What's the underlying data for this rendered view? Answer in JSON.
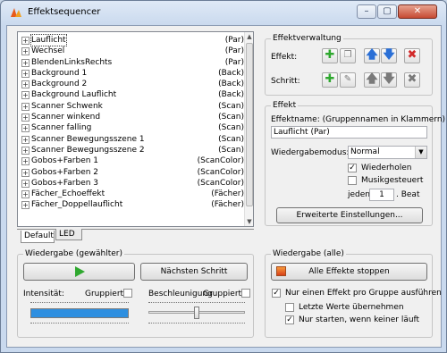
{
  "window": {
    "title": "Effektsequencer",
    "controls": [
      "–",
      "▢",
      "✕"
    ]
  },
  "effects": [
    {
      "name": "Lauflicht",
      "type": "(Par)",
      "selected": true
    },
    {
      "name": "Wechsel",
      "type": "(Par)"
    },
    {
      "name": "BlendenLinksRechts",
      "type": "(Par)"
    },
    {
      "name": "Background 1",
      "type": "(Back)"
    },
    {
      "name": "Background 2",
      "type": "(Back)"
    },
    {
      "name": "Background Lauflicht",
      "type": "(Back)"
    },
    {
      "name": "Scanner Schwenk",
      "type": "(Scan)"
    },
    {
      "name": "Scanner winkend",
      "type": "(Scan)"
    },
    {
      "name": "Scanner falling",
      "type": "(Scan)"
    },
    {
      "name": "Scanner Bewegungsszene 1",
      "type": "(Scan)"
    },
    {
      "name": "Scanner Bewegungsszene 2",
      "type": "(Scan)"
    },
    {
      "name": "Gobos+Farben 1",
      "type": "(ScanColor)"
    },
    {
      "name": "Gobos+Farben 2",
      "type": "(ScanColor)"
    },
    {
      "name": "Gobos+Farben 3",
      "type": "(ScanColor)"
    },
    {
      "name": "Fächer_Echoeffekt",
      "type": "(Fächer)"
    },
    {
      "name": "Fächer_Doppellauflicht",
      "type": "(Fächer)"
    }
  ],
  "tabs": [
    "Default",
    "LED"
  ],
  "verwaltung": {
    "title": "Effektverwaltung",
    "effekt_label": "Effekt:",
    "schritt_label": "Schritt:"
  },
  "effekt": {
    "title": "Effekt",
    "name_label": "Effektname: (Gruppennamen in Klammern)",
    "name_value": "Lauflicht (Par)",
    "mode_label": "Wiedergabemodus:",
    "mode_value": "Normal",
    "wiederholen_label": "Wiederholen",
    "wiederholen_checked": true,
    "musik_label": "Musikgesteuert",
    "musik_checked": false,
    "jeden_label": "jeden",
    "beat_value": "1",
    "beat_label": ". Beat",
    "advanced_button": "Erweiterte Einstellungen..."
  },
  "playback_selected": {
    "title": "Wiedergabe (gewählter)",
    "next_step_button": "Nächsten Schritt",
    "intensity_label": "Intensität:",
    "grouped_label_1": "Gruppiert",
    "accel_label": "Beschleunigung",
    "grouped_label_2": "Gruppiert",
    "intensity_level": 1.0,
    "accel_level": 0.5
  },
  "playback_all": {
    "title": "Wiedergabe (alle)",
    "stop_all_button": "Alle Effekte stoppen",
    "one_per_group_label": "Nur einen Effekt pro Gruppe ausführen",
    "one_per_group_checked": true,
    "last_values_label": "Letzte Werte übernehmen",
    "last_values_checked": false,
    "only_start_label": "Nur starten, wenn keiner läuft",
    "only_start_checked": true
  },
  "colors": {
    "accent": "#2e8fe0",
    "play": "#2fa82f",
    "delete": "#d22b2b"
  }
}
